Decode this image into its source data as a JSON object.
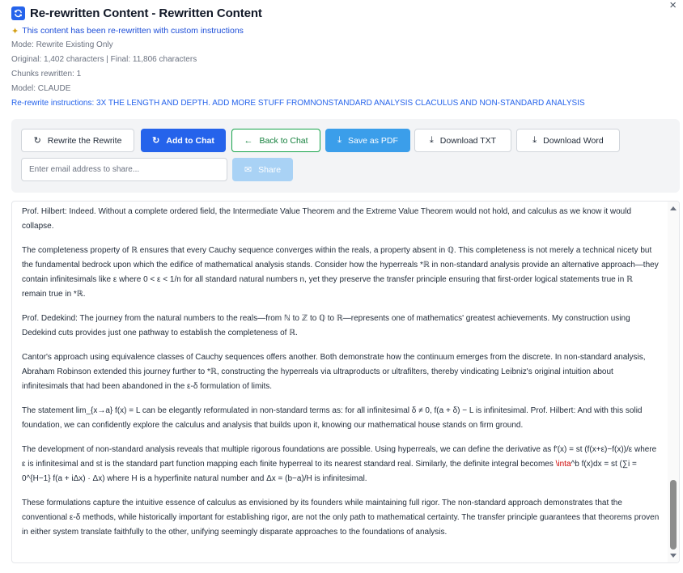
{
  "window": {
    "title": "Re-rewritten Content - Rewritten Content",
    "close": "×"
  },
  "header": {
    "notice": "This content has been re-rewritten with custom instructions",
    "mode": "Mode: Rewrite Existing Only",
    "counts": "Original: 1,402 characters | Final: 11,806 characters",
    "chunks": "Chunks rewritten: 1",
    "model": "Model: CLAUDE",
    "instructions": "Re-rewrite instructions: 3X THE LENGTH AND DEPTH. ADD MORE STUFF FROMNONSTANDARD ANALYSIS CLACULUS AND NON-STANDARD ANALYSIS"
  },
  "toolbar": {
    "rewrite_label": "Rewrite the Rewrite",
    "add_chat_label": "Add to Chat",
    "back_chat_label": "Back to Chat",
    "save_pdf_label": "Save as PDF",
    "download_txt_label": "Download TXT",
    "download_word_label": "Download Word",
    "email_placeholder": "Enter email address to share...",
    "share_label": "Share"
  },
  "icons": {
    "app": "refresh-icon",
    "notice": "sparkle-icon",
    "rewrite": "refresh-icon",
    "add_chat": "refresh-icon",
    "back": "arrow-left-icon",
    "save_pdf": "download-icon",
    "download_txt": "download-icon",
    "download_word": "download-icon",
    "share": "mail-icon"
  },
  "colors": {
    "primary": "#2563eb",
    "sky": "#3b9eea",
    "green": "#16a34a",
    "share_disabled": "#a9d2f5",
    "link": "#1d4ed8",
    "math_error": "#cc0000"
  },
  "content": {
    "p1": "Prof. Hilbert: Indeed. Without a complete ordered field, the Intermediate Value Theorem and the Extreme Value Theorem would not hold, and calculus as we know it would collapse.",
    "p2": "The completeness property of ℝ ensures that every Cauchy sequence converges within the reals, a property absent in ℚ. This completeness is not merely a technical nicety but the fundamental bedrock upon which the edifice of mathematical analysis stands. Consider how the hyperreals *ℝ in non-standard analysis provide an alternative approach—they contain infinitesimals like ε where 0 < ε < 1/n for all standard natural numbers n, yet they preserve the transfer principle ensuring that first-order logical statements true in ℝ remain true in *ℝ.",
    "p3": "Prof. Dedekind: The journey from the natural numbers to the reals—from ℕ to ℤ to ℚ to ℝ—represents one of mathematics' greatest achievements. My construction using Dedekind cuts provides just one pathway to establish the completeness of ℝ.",
    "p4": "Cantor's approach using equivalence classes of Cauchy sequences offers another. Both demonstrate how the continuum emerges from the discrete. In non-standard analysis, Abraham Robinson extended this journey further to *ℝ, constructing the hyperreals via ultraproducts or ultrafilters, thereby vindicating Leibniz's original intuition about infinitesimals that had been abandoned in the ε-δ formulation of limits.",
    "p5": "The statement lim_{x→a} f(x) = L can be elegantly reformulated in non-standard terms as: for all infinitesimal δ ≠ 0, f(a + δ) − L is infinitesimal. Prof. Hilbert: And with this solid foundation, we can confidently explore the calculus and analysis that builds upon it, knowing our mathematical house stands on firm ground.",
    "p6a": "The development of non-standard analysis reveals that multiple rigorous foundations are possible. Using hyperreals, we can define the derivative as f′(x) = st (f(x+ε)−f(x))/ε where ε is infinitesimal and st is the standard part function mapping each finite hyperreal to its nearest standard real. Similarly, the definite integral becomes",
    "p6_error": "\\inta",
    "p6b": "^b f(x)dx = st (∑i = 0^{H−1} f(a + iΔx) · Δx) where H is a hyperfinite natural number and Δx = (b−a)/H is infinitesimal.",
    "p7": "These formulations capture the intuitive essence of calculus as envisioned by its founders while maintaining full rigor. The non-standard approach demonstrates that the conventional ε-δ methods, while historically important for establishing rigor, are not the only path to mathematical certainty. The transfer principle guarantees that theorems proven in either system translate faithfully to the other, unifying seemingly disparate approaches to the foundations of analysis."
  }
}
